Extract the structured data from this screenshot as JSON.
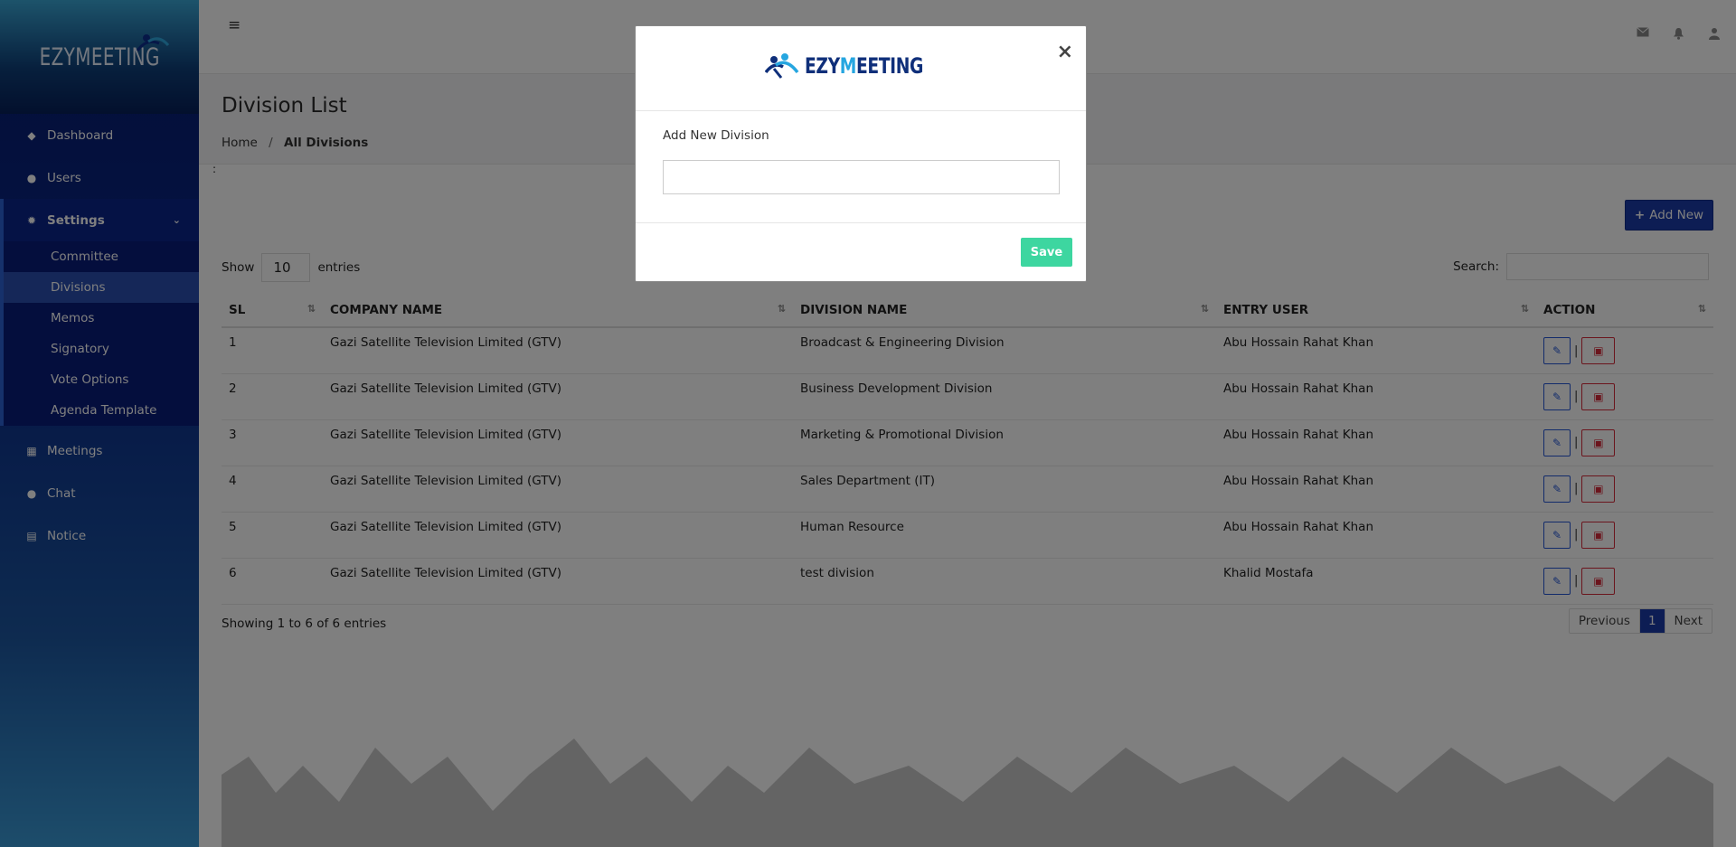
{
  "app": {
    "brand": "EZYMEETING"
  },
  "sidebar": {
    "items": [
      {
        "label": "Dashboard",
        "icon": "gem-icon"
      },
      {
        "label": "Users",
        "icon": "user-icon"
      },
      {
        "label": "Settings",
        "icon": "gear-icon"
      },
      {
        "label": "Meetings",
        "icon": "calendar-icon"
      },
      {
        "label": "Chat",
        "icon": "comment-icon"
      },
      {
        "label": "Notice",
        "icon": "copy-icon"
      }
    ],
    "settings_sub": [
      "Committee",
      "Divisions",
      "Memos",
      "Signatory",
      "Vote Options",
      "Agenda Template"
    ],
    "active_sub": "Divisions"
  },
  "header": {
    "menu_icon": "hamburger-icon",
    "icons": [
      "envelope-icon",
      "bell-icon",
      "user-icon"
    ]
  },
  "page": {
    "title": "Division List",
    "breadcrumb": {
      "home": "Home",
      "sep": "/",
      "current": "All Divisions"
    },
    "stray": ":"
  },
  "toolbar": {
    "add_label": "Add New",
    "add_icon": "+"
  },
  "table": {
    "show_label": "Show",
    "entries_value": "10",
    "entries_label": "entries",
    "search_label": "Search:",
    "columns": [
      "SL",
      "COMPANY NAME",
      "DIVISION NAME",
      "ENTRY USER",
      "ACTION"
    ],
    "rows": [
      {
        "sl": "1",
        "company": "Gazi Satellite Television Limited (GTV)",
        "division": "Broadcast & Engineering Division",
        "user": "Abu Hossain Rahat Khan"
      },
      {
        "sl": "2",
        "company": "Gazi Satellite Television Limited (GTV)",
        "division": "Business Development Division",
        "user": "Abu Hossain Rahat Khan"
      },
      {
        "sl": "3",
        "company": "Gazi Satellite Television Limited (GTV)",
        "division": "Marketing & Promotional Division",
        "user": "Abu Hossain Rahat Khan"
      },
      {
        "sl": "4",
        "company": "Gazi Satellite Television Limited (GTV)",
        "division": "Sales Department (IT)",
        "user": "Abu Hossain Rahat Khan"
      },
      {
        "sl": "5",
        "company": "Gazi Satellite Television Limited (GTV)",
        "division": "Human Resource",
        "user": "Abu Hossain Rahat Khan"
      },
      {
        "sl": "6",
        "company": "Gazi Satellite Television Limited (GTV)",
        "division": "test division",
        "user": "Khalid Mostafa"
      }
    ],
    "info": "Showing 1 to 6 of 6 entries",
    "pager": {
      "prev": "Previous",
      "current": "1",
      "next": "Next"
    }
  },
  "modal": {
    "logo_pre": "EZY",
    "logo_m": "M",
    "logo_post": "EETING",
    "close": "×",
    "field_label": "Add New Division",
    "field_value": "",
    "save_label": "Save"
  },
  "colors": {
    "primary": "#1b3aa8",
    "save": "#3dd6a0",
    "danger": "#d62a3a",
    "overlay": "rgba(0,0,0,0.5)"
  }
}
